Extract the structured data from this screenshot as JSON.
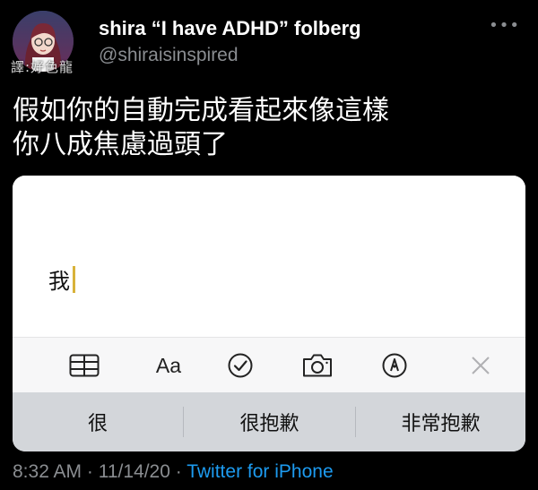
{
  "author": {
    "display_name": "shira “I have ADHD” folberg",
    "handle": "@shiraisinspired",
    "avatar": "avatar-illustration",
    "watermark": "譯:好色龍"
  },
  "more_icon": "more-horizontal-icon",
  "tweet": {
    "lines": [
      "假如你的自動完成看起來像這樣",
      "你八成焦慮過頭了"
    ]
  },
  "screenshot": {
    "typed_text": "我",
    "toolbar_icons": [
      "table-icon",
      "text-format-icon",
      "checklist-icon",
      "camera-icon",
      "markup-pen-icon",
      "close-icon"
    ],
    "text_format_label": "Aa",
    "suggestions": [
      "很",
      "很抱歉",
      "非常抱歉"
    ]
  },
  "footer": {
    "time": "8:32 AM",
    "separator": " · ",
    "date": "11/14/20",
    "source": "Twitter for iPhone"
  },
  "colors": {
    "background": "#000000",
    "link": "#1d9bf0",
    "muted": "#8a8d91",
    "cursor": "#d8b23a",
    "suggestion_bar": "#d3d6da"
  }
}
